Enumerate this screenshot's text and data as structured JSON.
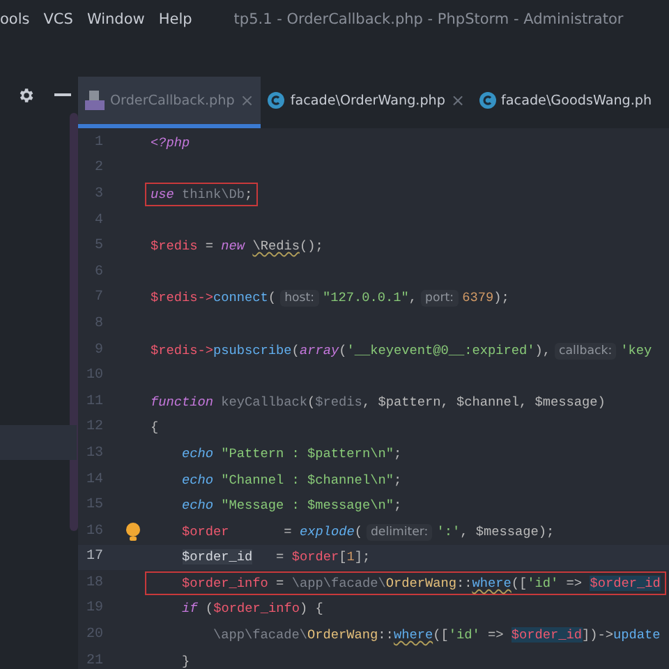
{
  "menu": [
    "ools",
    "VCS",
    "Window",
    "Help"
  ],
  "window": {
    "title": "tp5.1 - OrderCallback.php - PhpStorm - Administrator"
  },
  "tabs": [
    {
      "label": "OrderCallback.php",
      "kind": "php",
      "selected": true,
      "close": "×"
    },
    {
      "label": "facade\\OrderWang.php",
      "kind": "class",
      "selected": false,
      "close": "×"
    },
    {
      "label": "facade\\GoodsWang.ph",
      "kind": "class",
      "selected": false
    }
  ],
  "lines": [
    {
      "number": "1",
      "current": false,
      "boxed": false,
      "tokens": [
        {
          "t": "<?php",
          "kind": "kw"
        }
      ]
    },
    {
      "number": "2",
      "current": false,
      "boxed": false
    },
    {
      "number": "3",
      "current": false,
      "boxed": true,
      "tokens": [
        {
          "t": "use",
          "kind": "kw"
        },
        {
          "t": " think\\Db",
          "kind": "dim"
        },
        {
          "t": ";",
          "kind": "plain"
        }
      ]
    },
    {
      "number": "4",
      "current": false,
      "boxed": false
    },
    {
      "number": "5",
      "current": false,
      "boxed": false,
      "tokens": [
        {
          "t": "$redis",
          "kind": "var"
        },
        {
          "t": " = ",
          "kind": "plain"
        },
        {
          "t": "new ",
          "kind": "kw"
        },
        {
          "t": "\\Redis",
          "kind": "warn"
        },
        {
          "t": "();",
          "kind": "plain"
        }
      ]
    },
    {
      "number": "6",
      "current": false,
      "boxed": false
    },
    {
      "number": "7",
      "current": false,
      "boxed": false,
      "tokens": [
        {
          "t": "$redis",
          "kind": "var"
        },
        {
          "t": "->",
          "kind": "var"
        },
        {
          "t": "connect",
          "kind": "fn"
        },
        {
          "t": "(",
          "kind": "plain"
        },
        {
          "t": "host:",
          "kind": "hint"
        },
        {
          "t": "\"127.0.0.1\"",
          "kind": "str"
        },
        {
          "t": ",",
          "kind": "plain"
        },
        {
          "t": "port:",
          "kind": "hint"
        },
        {
          "t": "6379",
          "kind": "num"
        },
        {
          "t": ");",
          "kind": "plain"
        }
      ]
    },
    {
      "number": "8",
      "current": false,
      "boxed": false
    },
    {
      "number": "9",
      "current": false,
      "boxed": false,
      "tokens": [
        {
          "t": "$redis",
          "kind": "var"
        },
        {
          "t": "->",
          "kind": "var"
        },
        {
          "t": "psubscribe",
          "kind": "fn"
        },
        {
          "t": "(",
          "kind": "plain"
        },
        {
          "t": "array",
          "kind": "kw"
        },
        {
          "t": "(",
          "kind": "plain"
        },
        {
          "t": "'__keyevent@0__:expired'",
          "kind": "str"
        },
        {
          "t": "),",
          "kind": "plain"
        },
        {
          "t": "callback:",
          "kind": "hint"
        },
        {
          "t": "'key",
          "kind": "str"
        }
      ]
    },
    {
      "number": "10",
      "current": false,
      "boxed": false
    },
    {
      "number": "11",
      "current": false,
      "boxed": false,
      "tokens": [
        {
          "t": "function ",
          "kind": "kw"
        },
        {
          "t": "keyCallback",
          "kind": "dim"
        },
        {
          "t": "(",
          "kind": "plain"
        },
        {
          "t": "$redis",
          "kind": "dim"
        },
        {
          "t": ", $pattern, $channel, $message)",
          "kind": "plain"
        }
      ]
    },
    {
      "number": "12",
      "current": false,
      "boxed": false,
      "tokens": [
        {
          "t": "{",
          "kind": "plain"
        }
      ]
    },
    {
      "number": "13",
      "current": false,
      "boxed": false,
      "tokens": [
        {
          "t": "    echo",
          "kind": "fn_i"
        },
        {
          "t": " \"Pattern : $pattern\\n\"",
          "kind": "str"
        },
        {
          "t": ";",
          "kind": "plain"
        }
      ]
    },
    {
      "number": "14",
      "current": false,
      "boxed": false,
      "tokens": [
        {
          "t": "    echo",
          "kind": "fn_i"
        },
        {
          "t": " \"Channel : $channel\\n\"",
          "kind": "str"
        },
        {
          "t": ";",
          "kind": "plain"
        }
      ]
    },
    {
      "number": "15",
      "current": false,
      "boxed": false,
      "tokens": [
        {
          "t": "    echo",
          "kind": "fn_i"
        },
        {
          "t": " \"Message : $message\\n\"",
          "kind": "str"
        },
        {
          "t": ";",
          "kind": "plain"
        }
      ]
    },
    {
      "number": "16",
      "current": false,
      "boxed": false,
      "bulb": true,
      "tokens": [
        {
          "t": "    $order",
          "kind": "var"
        },
        {
          "t": "       = ",
          "kind": "plain"
        },
        {
          "t": "explode",
          "kind": "fn_i"
        },
        {
          "t": "(",
          "kind": "plain"
        },
        {
          "t": "delimiter:",
          "kind": "hint"
        },
        {
          "t": "':'",
          "kind": "str"
        },
        {
          "t": ", $message);",
          "kind": "plain"
        }
      ]
    },
    {
      "number": "17",
      "current": true,
      "boxed": false,
      "tokens": [
        {
          "t": "    $order_id",
          "kind": "var_cur"
        },
        {
          "t": "   = ",
          "kind": "plain"
        },
        {
          "t": "$order",
          "kind": "var"
        },
        {
          "t": "[",
          "kind": "plain"
        },
        {
          "t": "1",
          "kind": "num"
        },
        {
          "t": "];",
          "kind": "plain"
        }
      ]
    },
    {
      "number": "18",
      "current": false,
      "boxed": true,
      "tokens": [
        {
          "t": "    $order_info",
          "kind": "var"
        },
        {
          "t": " = ",
          "kind": "plain"
        },
        {
          "t": "\\app\\facade\\",
          "kind": "dim"
        },
        {
          "t": "OrderWang",
          "kind": "cls"
        },
        {
          "t": "::",
          "kind": "plain"
        },
        {
          "t": "where",
          "kind": "fn_warn"
        },
        {
          "t": "([",
          "kind": "plain"
        },
        {
          "t": "'id'",
          "kind": "str"
        },
        {
          "t": " => ",
          "kind": "plain"
        },
        {
          "t": "$order_id",
          "kind": "var_hl"
        }
      ]
    },
    {
      "number": "19",
      "current": false,
      "boxed": false,
      "tokens": [
        {
          "t": "    if",
          "kind": "kw"
        },
        {
          "t": " (",
          "kind": "plain"
        },
        {
          "t": "$order_info",
          "kind": "var"
        },
        {
          "t": ") {",
          "kind": "plain"
        }
      ]
    },
    {
      "number": "20",
      "current": false,
      "boxed": false,
      "tokens": [
        {
          "t": "        \\app\\facade\\",
          "kind": "dim"
        },
        {
          "t": "OrderWang",
          "kind": "cls"
        },
        {
          "t": "::",
          "kind": "plain"
        },
        {
          "t": "where",
          "kind": "fn_warn"
        },
        {
          "t": "([",
          "kind": "plain"
        },
        {
          "t": "'id'",
          "kind": "str"
        },
        {
          "t": " => ",
          "kind": "plain"
        },
        {
          "t": "$order_id",
          "kind": "var_hl"
        },
        {
          "t": "])->",
          "kind": "plain"
        },
        {
          "t": "update",
          "kind": "fn"
        }
      ]
    },
    {
      "number": "21",
      "current": false,
      "boxed": false,
      "tokens": [
        {
          "t": "    }",
          "kind": "plain"
        }
      ]
    }
  ]
}
